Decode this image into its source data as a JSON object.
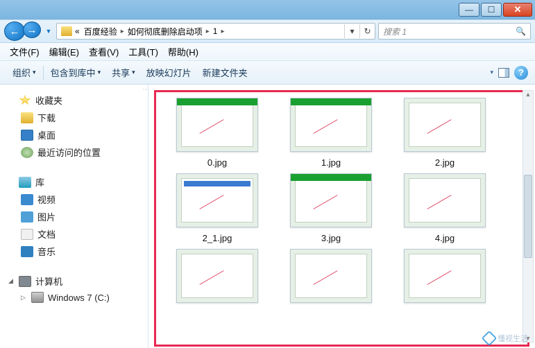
{
  "window": {
    "minimize": "—",
    "maximize": "☐",
    "close": "✕"
  },
  "nav": {
    "back": "←",
    "forward": "→",
    "dropdown": "▼",
    "refresh": "↻"
  },
  "breadcrumb": {
    "prefix": "«",
    "seg1": "百度经验",
    "seg2": "如何彻底删除启动项",
    "seg3": "1",
    "sep": "▸",
    "dd": "▾"
  },
  "search": {
    "placeholder": "搜索 1",
    "icon": "🔍"
  },
  "menu": {
    "file": "文件(F)",
    "edit": "编辑(E)",
    "view": "查看(V)",
    "tools": "工具(T)",
    "help": "帮助(H)"
  },
  "toolbar": {
    "organize": "组织",
    "include": "包含到库中",
    "share": "共享",
    "slideshow": "放映幻灯片",
    "newfolder": "新建文件夹",
    "dd": "▾",
    "help": "?"
  },
  "sidebar": {
    "fav_header": "收藏夹",
    "downloads": "下载",
    "desktop": "桌面",
    "recent": "最近访问的位置",
    "lib_header": "库",
    "videos": "视频",
    "pictures": "图片",
    "documents": "文档",
    "music": "音乐",
    "computer": "计算机",
    "drive_c": "Windows 7 (C:)"
  },
  "files": [
    {
      "name": "0.jpg",
      "variant": "green"
    },
    {
      "name": "1.jpg",
      "variant": "green"
    },
    {
      "name": "2.jpg",
      "variant": "plain"
    },
    {
      "name": "2_1.jpg",
      "variant": "blue"
    },
    {
      "name": "3.jpg",
      "variant": "green"
    },
    {
      "name": "4.jpg",
      "variant": "plain"
    },
    {
      "name": "",
      "variant": "plain"
    },
    {
      "name": "",
      "variant": "plain"
    },
    {
      "name": "",
      "variant": "plain"
    }
  ],
  "watermark": "懂视生活"
}
